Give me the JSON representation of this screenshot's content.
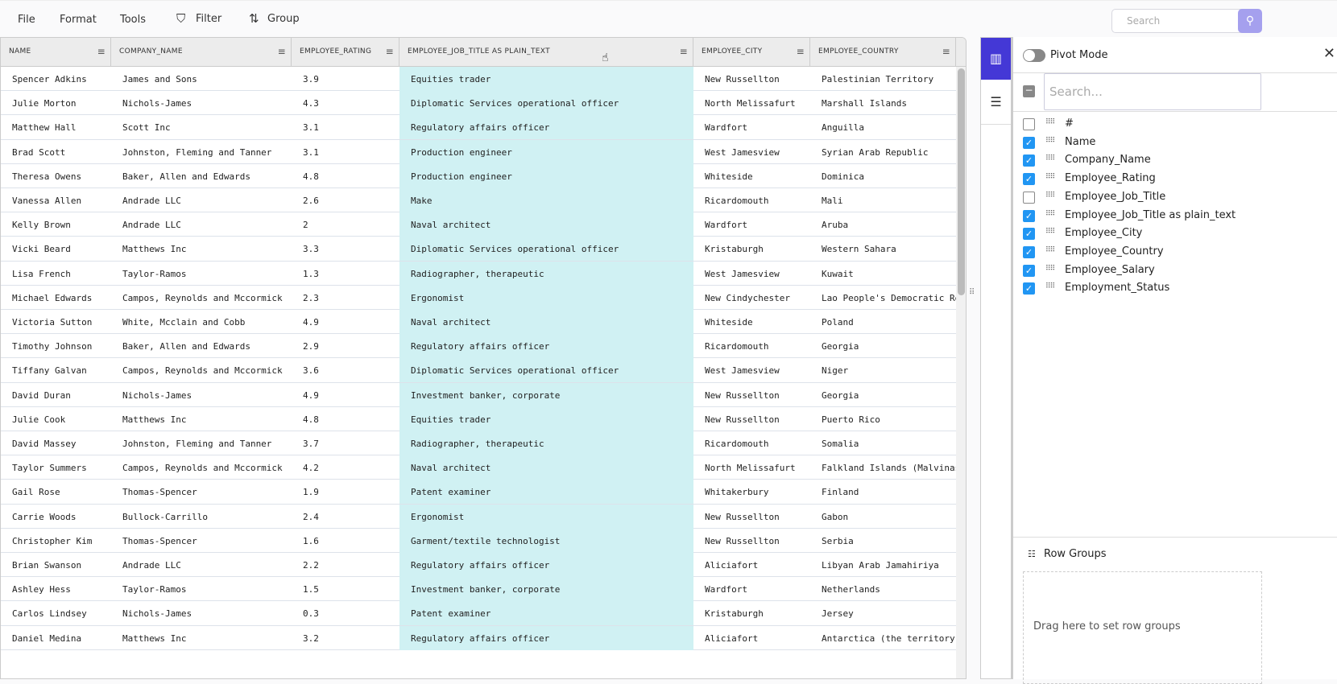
{
  "toolbar": {
    "file": "File",
    "format": "Format",
    "tools": "Tools",
    "filter": "Filter",
    "group": "Group",
    "search_placeholder": "Search"
  },
  "columns": [
    "NAME",
    "COMPANY_NAME",
    "EMPLOYEE_RATING",
    "EMPLOYEE_JOB_TITLE AS PLAIN_TEXT",
    "EMPLOYEE_CITY",
    "EMPLOYEE_COUNTRY"
  ],
  "rows": [
    [
      "Spencer Adkins",
      "James and Sons",
      "3.9",
      "Equities trader",
      "New Russellton",
      "Palestinian Territory"
    ],
    [
      "Julie Morton",
      "Nichols-James",
      "4.3",
      "Diplomatic Services operational officer",
      "North Melissafurt",
      "Marshall Islands"
    ],
    [
      "Matthew Hall",
      "Scott Inc",
      "3.1",
      "Regulatory affairs officer",
      "Wardfort",
      "Anguilla"
    ],
    [
      "Brad Scott",
      "Johnston, Fleming and Tanner",
      "3.1",
      "Production engineer",
      "West Jamesview",
      "Syrian Arab Republic"
    ],
    [
      "Theresa Owens",
      "Baker, Allen and Edwards",
      "4.8",
      "Production engineer",
      "Whiteside",
      "Dominica"
    ],
    [
      "Vanessa Allen",
      "Andrade LLC",
      "2.6",
      "Make",
      "Ricardomouth",
      "Mali"
    ],
    [
      "Kelly Brown",
      "Andrade LLC",
      "2",
      "Naval architect",
      "Wardfort",
      "Aruba"
    ],
    [
      "Vicki Beard",
      "Matthews Inc",
      "3.3",
      "Diplomatic Services operational officer",
      "Kristaburgh",
      "Western Sahara"
    ],
    [
      "Lisa French",
      "Taylor-Ramos",
      "1.3",
      "Radiographer, therapeutic",
      "West Jamesview",
      "Kuwait"
    ],
    [
      "Michael Edwards",
      "Campos, Reynolds and Mccormick",
      "2.3",
      "Ergonomist",
      "New Cindychester",
      "Lao People's Democratic Rep"
    ],
    [
      "Victoria Sutton",
      "White, Mcclain and Cobb",
      "4.9",
      "Naval architect",
      "Whiteside",
      "Poland"
    ],
    [
      "Timothy Johnson",
      "Baker, Allen and Edwards",
      "2.9",
      "Regulatory affairs officer",
      "Ricardomouth",
      "Georgia"
    ],
    [
      "Tiffany Galvan",
      "Campos, Reynolds and Mccormick",
      "3.6",
      "Diplomatic Services operational officer",
      "West Jamesview",
      "Niger"
    ],
    [
      "David Duran",
      "Nichols-James",
      "4.9",
      "Investment banker, corporate",
      "New Russellton",
      "Georgia"
    ],
    [
      "Julie Cook",
      "Matthews Inc",
      "4.8",
      "Equities trader",
      "New Russellton",
      "Puerto Rico"
    ],
    [
      "David Massey",
      "Johnston, Fleming and Tanner",
      "3.7",
      "Radiographer, therapeutic",
      "Ricardomouth",
      "Somalia"
    ],
    [
      "Taylor Summers",
      "Campos, Reynolds and Mccormick",
      "4.2",
      "Naval architect",
      "North Melissafurt",
      "Falkland Islands (Malvinas)"
    ],
    [
      "Gail Rose",
      "Thomas-Spencer",
      "1.9",
      "Patent examiner",
      "Whitakerbury",
      "Finland"
    ],
    [
      "Carrie Woods",
      "Bullock-Carrillo",
      "2.4",
      "Ergonomist",
      "New Russellton",
      "Gabon"
    ],
    [
      "Christopher Kim",
      "Thomas-Spencer",
      "1.6",
      "Garment/textile technologist",
      "New Russellton",
      "Serbia"
    ],
    [
      "Brian Swanson",
      "Andrade LLC",
      "2.2",
      "Regulatory affairs officer",
      "Aliciafort",
      "Libyan Arab Jamahiriya"
    ],
    [
      "Ashley Hess",
      "Taylor-Ramos",
      "1.5",
      "Investment banker, corporate",
      "Wardfort",
      "Netherlands"
    ],
    [
      "Carlos Lindsey",
      "Nichols-James",
      "0.3",
      "Patent examiner",
      "Kristaburgh",
      "Jersey"
    ],
    [
      "Daniel Medina",
      "Matthews Inc",
      "3.2",
      "Regulatory affairs officer",
      "Aliciafort",
      "Antarctica (the territory S"
    ]
  ],
  "panel": {
    "pivot_mode": "Pivot Mode",
    "search_placeholder": "Search...",
    "columns": [
      {
        "label": "#",
        "checked": false
      },
      {
        "label": "Name",
        "checked": true
      },
      {
        "label": "Company_Name",
        "checked": true
      },
      {
        "label": "Employee_Rating",
        "checked": true
      },
      {
        "label": "Employee_Job_Title",
        "checked": false
      },
      {
        "label": "Employee_Job_Title as plain_text",
        "checked": true
      },
      {
        "label": "Employee_City",
        "checked": true
      },
      {
        "label": "Employee_Country",
        "checked": true
      },
      {
        "label": "Employee_Salary",
        "checked": true
      },
      {
        "label": "Employment_Status",
        "checked": true
      }
    ],
    "row_groups": "Row Groups",
    "row_groups_hint": "Drag here to set row groups"
  },
  "colors": {
    "accent": "#4438d6",
    "highlight": "#d0f1f3",
    "checkbox": "#2196f3"
  }
}
